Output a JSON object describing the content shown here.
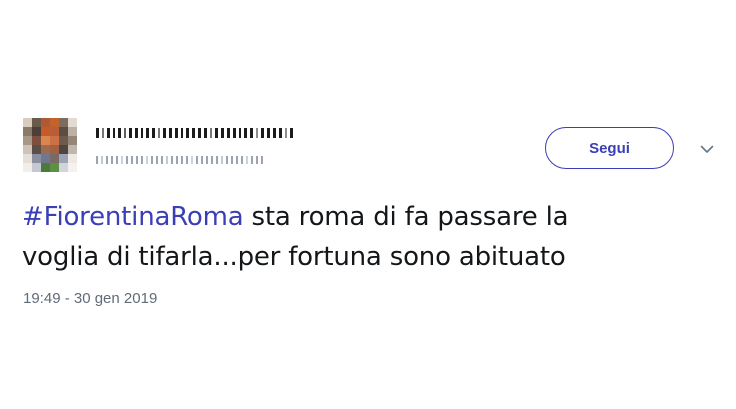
{
  "tweet": {
    "follow_label": "Segui",
    "hashtag": "#FiorentinaRoma",
    "text_line1_rest": " sta roma di fa passare la",
    "text_line2": "voglia di tifarla...per fortuna sono abituato",
    "timestamp": "19:49 - 30 gen 2019"
  },
  "colors": {
    "accent": "#3b3fb6",
    "text": "#14171a",
    "muted": "#5f6b77"
  },
  "icons": {
    "caret": "chevron-down-icon"
  }
}
